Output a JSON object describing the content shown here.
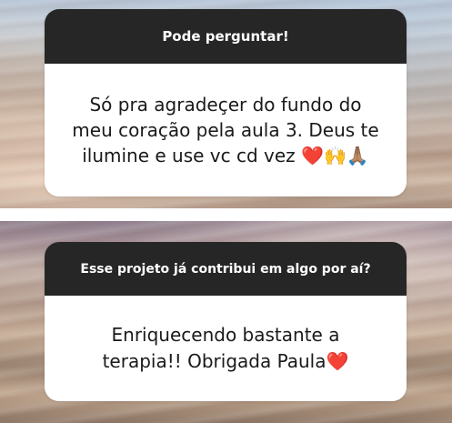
{
  "stories": [
    {
      "question": "Pode perguntar!",
      "answer_lines": [
        "Só pra agradeçer do fundo do",
        "meu coração pela aula 3. Deus te",
        "ilumine e use vc cd vez"
      ],
      "emojis": [
        "heart-emoji",
        "raised-hands-emoji",
        "folded-hands-emoji"
      ],
      "emoji_glyphs": {
        "heart": "❤️",
        "raised_hands": "🙌",
        "folded_hands": "🙏🏽"
      }
    },
    {
      "question": "Esse projeto já contribui em algo por aí?",
      "answer_lines": [
        "Enriquecendo bastante a",
        "terapia!! Obrigada Paula"
      ],
      "emojis": [
        "heart-emoji"
      ],
      "emoji_glyphs": {
        "heart": "❤️"
      }
    }
  ],
  "colors": {
    "header_bg": "#262626",
    "header_text": "#ffffff",
    "body_bg": "#ffffff",
    "body_text": "#1a1a1a",
    "heart": "#e0202a"
  }
}
